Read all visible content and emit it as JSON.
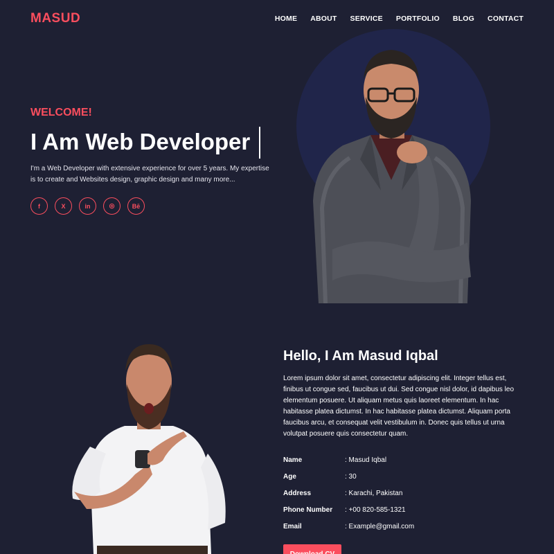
{
  "header": {
    "logo": "MASUD",
    "nav": [
      "HOME",
      "ABOUT",
      "SERVICE",
      "PORTFOLIO",
      "BLOG",
      "CONTACT"
    ]
  },
  "hero": {
    "welcome": "WELCOME!",
    "title": "I Am Web Developer",
    "description": "I'm a Web Developer with extensive experience for over 5 years. My expertise is to create and Websites design, graphic design and many more...",
    "socials": [
      {
        "icon": "facebook-icon",
        "glyph": "f"
      },
      {
        "icon": "x-twitter-icon",
        "glyph": "X"
      },
      {
        "icon": "linkedin-icon",
        "glyph": "in"
      },
      {
        "icon": "instagram-icon",
        "glyph": "◎"
      },
      {
        "icon": "behance-icon",
        "glyph": "Bē"
      }
    ]
  },
  "about": {
    "title": "Hello, I Am Masud Iqbal",
    "description": "Lorem ipsum dolor sit amet, consectetur adipiscing elit. Integer tellus est, finibus ut congue sed, faucibus ut dui. Sed congue nisl dolor, id dapibus leo elementum posuere. Ut aliquam metus quis laoreet elementum. In hac habitasse platea dictumst. In hac habitasse platea dictumst. Aliquam porta faucibus arcu, et consequat velit vestibulum in. Donec quis tellus ut urna volutpat posuere quis consectetur quam.",
    "info": [
      {
        "label": "Name",
        "value": ": Masud Iqbal"
      },
      {
        "label": "Age",
        "value": ": 30"
      },
      {
        "label": "Address",
        "value": ": Karachi, Pakistan"
      },
      {
        "label": "Phone Number",
        "value": ": +00 820-585-1321"
      },
      {
        "label": "Email",
        "value": ": Example@gmail.com"
      }
    ],
    "button_label": "Download CV"
  },
  "colors": {
    "background": "#1e2033",
    "accent": "#fb4e5e",
    "circle": "#20254a"
  }
}
